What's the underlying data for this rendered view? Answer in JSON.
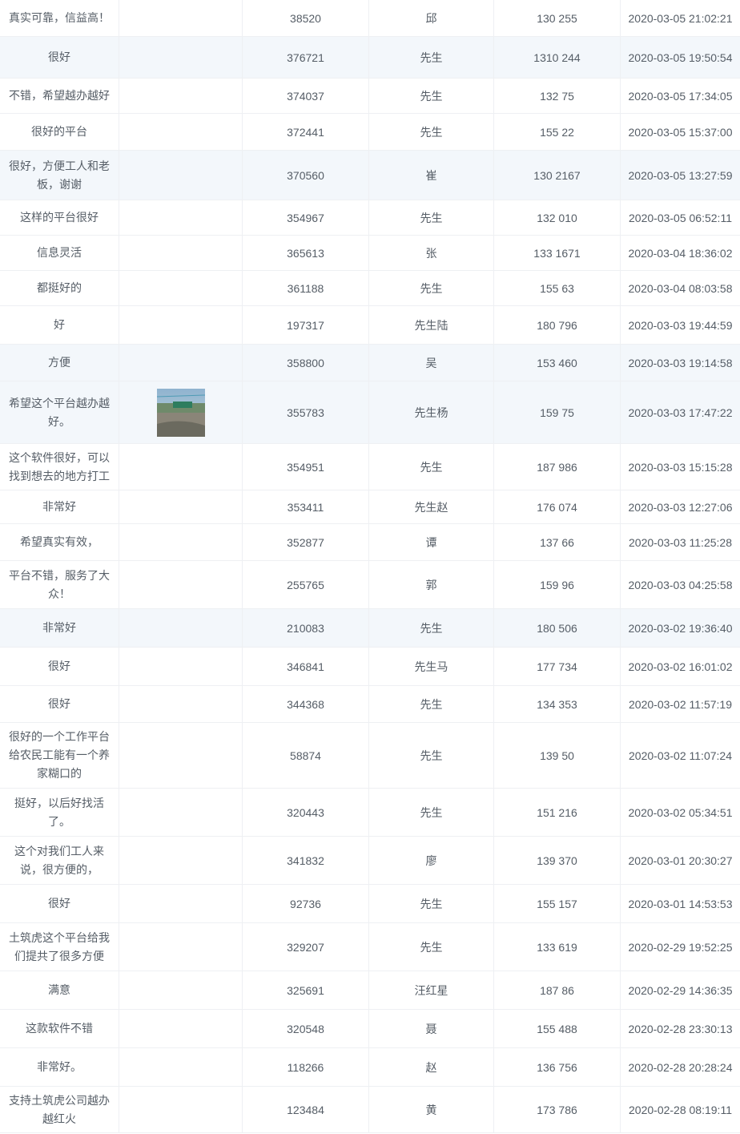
{
  "rows": [
    {
      "text": "真实可靠，信益高！",
      "id": "38520",
      "name": "邱",
      "phone": "130 255",
      "time": "2020-03-05 21:02:21",
      "h": 46,
      "hl": false
    },
    {
      "text": "很好",
      "id": "376721",
      "name": "先生",
      "phone": "1310 244",
      "time": "2020-03-05 19:50:54",
      "h": 52,
      "hl": true
    },
    {
      "text": "不错，希望越办越好",
      "id": "374037",
      "name": "先生",
      "phone": "132 75",
      "time": "2020-03-05 17:34:05",
      "h": 44,
      "hl": false
    },
    {
      "text": "很好的平台",
      "id": "372441",
      "name": "先生",
      "phone": "155 22",
      "time": "2020-03-05 15:37:00",
      "h": 46,
      "hl": false
    },
    {
      "text": "很好，方便工人和老板，谢谢",
      "id": "370560",
      "name": "崔",
      "phone": "130 2167",
      "time": "2020-03-05 13:27:59",
      "h": 62,
      "hl": true
    },
    {
      "text": "这样的平台很好",
      "id": "354967",
      "name": "先生",
      "phone": "132 010",
      "time": "2020-03-05 06:52:11",
      "h": 44,
      "hl": false
    },
    {
      "text": "信息灵活",
      "id": "365613",
      "name": "张",
      "phone": "133 1671",
      "time": "2020-03-04 18:36:02",
      "h": 44,
      "hl": false
    },
    {
      "text": "都挺好的",
      "id": "361188",
      "name": "先生",
      "phone": "155 63",
      "time": "2020-03-04 08:03:58",
      "h": 44,
      "hl": false
    },
    {
      "text": "好",
      "id": "197317",
      "name": "先生陆",
      "phone": "180 796",
      "time": "2020-03-03 19:44:59",
      "h": 48,
      "hl": false
    },
    {
      "text": "方便",
      "id": "358800",
      "name": "吴",
      "phone": "153 460",
      "time": "2020-03-03 19:14:58",
      "h": 46,
      "hl": true
    },
    {
      "text": "希望这个平台越办越好。",
      "id": "355783",
      "name": "先生杨",
      "phone": "159 75",
      "time": "2020-03-03 17:47:22",
      "h": 78,
      "hl": true,
      "img": true
    },
    {
      "text": "这个软件很好，可以找到想去的地方打工",
      "id": "354951",
      "name": "先生",
      "phone": "187 986",
      "time": "2020-03-03 15:15:28",
      "h": 58,
      "hl": false
    },
    {
      "text": "非常好",
      "id": "353411",
      "name": "先生赵",
      "phone": "176 074",
      "time": "2020-03-03 12:27:06",
      "h": 42,
      "hl": false
    },
    {
      "text": "希望真实有效，",
      "id": "352877",
      "name": "谭",
      "phone": "137 66",
      "time": "2020-03-03 11:25:28",
      "h": 46,
      "hl": false
    },
    {
      "text": "平台不错，服务了大众！",
      "id": "255765",
      "name": "郭",
      "phone": "159 96",
      "time": "2020-03-03 04:25:58",
      "h": 60,
      "hl": false
    },
    {
      "text": "非常好",
      "id": "210083",
      "name": "先生",
      "phone": "180 506",
      "time": "2020-03-02 19:36:40",
      "h": 48,
      "hl": true
    },
    {
      "text": "很好",
      "id": "346841",
      "name": "先生马",
      "phone": "177 734",
      "time": "2020-03-02 16:01:02",
      "h": 48,
      "hl": false
    },
    {
      "text": "很好",
      "id": "344368",
      "name": "先生",
      "phone": "134 353",
      "time": "2020-03-02 11:57:19",
      "h": 46,
      "hl": false
    },
    {
      "text": "很好的一个工作平台给农民工能有一个养家糊口的",
      "id": "58874",
      "name": "先生",
      "phone": "139 50",
      "time": "2020-03-02 11:07:24",
      "h": 82,
      "hl": false
    },
    {
      "text": "挺好，以后好找活了。",
      "id": "320443",
      "name": "先生",
      "phone": "151 216",
      "time": "2020-03-02 05:34:51",
      "h": 60,
      "hl": false
    },
    {
      "text": "这个对我们工人来说，很方便的，",
      "id": "341832",
      "name": "廖",
      "phone": "139 370",
      "time": "2020-03-01 20:30:27",
      "h": 60,
      "hl": false
    },
    {
      "text": "很好",
      "id": "92736",
      "name": "先生",
      "phone": "155 157",
      "time": "2020-03-01 14:53:53",
      "h": 48,
      "hl": false
    },
    {
      "text": "土筑虎这个平台给我们提共了很多方便",
      "id": "329207",
      "name": "先生",
      "phone": "133 619",
      "time": "2020-02-29 19:52:25",
      "h": 60,
      "hl": false
    },
    {
      "text": "满意",
      "id": "325691",
      "name": "汪红星",
      "phone": "187 86",
      "time": "2020-02-29 14:36:35",
      "h": 48,
      "hl": false
    },
    {
      "text": "这款软件不错",
      "id": "320548",
      "name": "聂",
      "phone": "155 488",
      "time": "2020-02-28 23:30:13",
      "h": 48,
      "hl": false
    },
    {
      "text": "非常好。",
      "id": "118266",
      "name": "赵",
      "phone": "136 756",
      "time": "2020-02-28 20:28:24",
      "h": 48,
      "hl": false
    },
    {
      "text": "支持土筑虎公司越办越红火",
      "id": "123484",
      "name": "黄",
      "phone": "173 786",
      "time": "2020-02-28 08:19:11",
      "h": 58,
      "hl": false
    }
  ]
}
